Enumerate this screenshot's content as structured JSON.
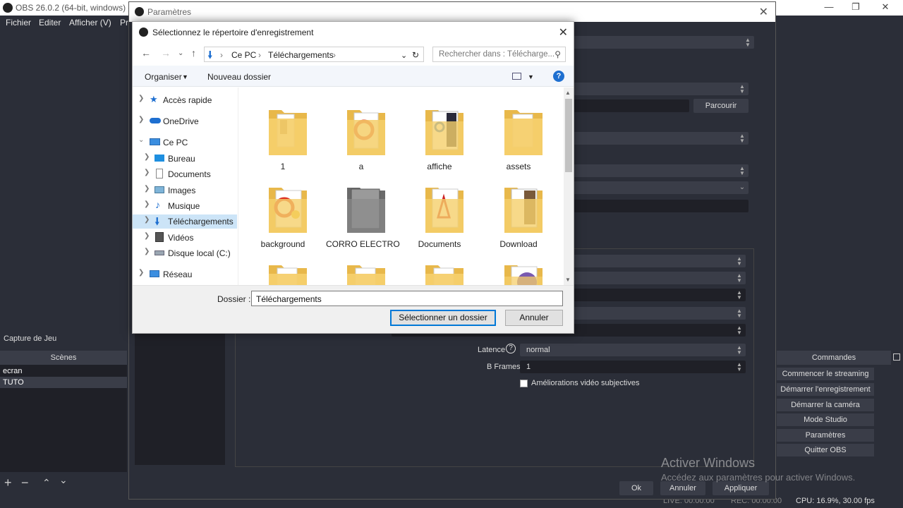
{
  "obs": {
    "title": "OBS 26.0.2 (64-bit, windows) - P",
    "menu": [
      "Fichier",
      "Editer",
      "Afficher (V)",
      "Pr"
    ],
    "capture_label": "Capture de Jeu",
    "scenes_header": "Scènes",
    "scenes": [
      "ecran",
      "TUTO"
    ],
    "controls_header": "Commandes",
    "controls": [
      "Commencer le streaming",
      "Démarrer l'enregistrement",
      "Démarrer la caméra virtuelle",
      "Mode Studio",
      "Paramètres",
      "Quitter OBS"
    ],
    "status_cpu": "CPU: 16.9%, 30.00 fps",
    "status_live": "LIVE: 00:00:00",
    "status_rec": "REC: 00:00:00"
  },
  "params": {
    "title": "Paramètres",
    "browse": "Parcourir",
    "latency_label": "Latence",
    "latency_value": "normal",
    "bframes_label": "B Frames",
    "bframes_value": "1",
    "psycho_label": "Améliorations vidéo subjectives",
    "ok": "Ok",
    "cancel": "Annuler",
    "apply": "Appliquer"
  },
  "watermark": {
    "line1": "Activer Windows",
    "line2": "Accédez aux paramètres pour activer Windows."
  },
  "picker": {
    "title": "Sélectionnez le répertoire d'enregistrement",
    "path": [
      "Ce PC",
      "Téléchargements"
    ],
    "search_placeholder": "Rechercher dans : Télécharge...",
    "organize": "Organiser",
    "new_folder": "Nouveau dossier",
    "tree": [
      {
        "label": "Accès rapide",
        "icon": "star-icon"
      },
      {
        "label": "OneDrive",
        "icon": "cloud-icon"
      },
      {
        "label": "Ce PC",
        "icon": "computer-icon"
      },
      {
        "label": "Bureau",
        "icon": "desktop-icon"
      },
      {
        "label": "Documents",
        "icon": "document-icon"
      },
      {
        "label": "Images",
        "icon": "image-icon"
      },
      {
        "label": "Musique",
        "icon": "music-icon"
      },
      {
        "label": "Téléchargements",
        "icon": "download-icon"
      },
      {
        "label": "Vidéos",
        "icon": "video-icon"
      },
      {
        "label": "Disque local (C:)",
        "icon": "drive-icon"
      },
      {
        "label": "Réseau",
        "icon": "network-icon"
      }
    ],
    "folders": [
      "1",
      "a",
      "affiche",
      "assets",
      "background",
      "CORRO ELECTRO",
      "Documents",
      "Download"
    ],
    "folder_label": "Dossier :",
    "folder_value": "Téléchargements",
    "select_btn": "Sélectionner un dossier",
    "cancel_btn": "Annuler"
  },
  "colors": {
    "obs_bg": "#2b2e38",
    "accent": "#0078d7",
    "folder": "#f5cf6b"
  }
}
